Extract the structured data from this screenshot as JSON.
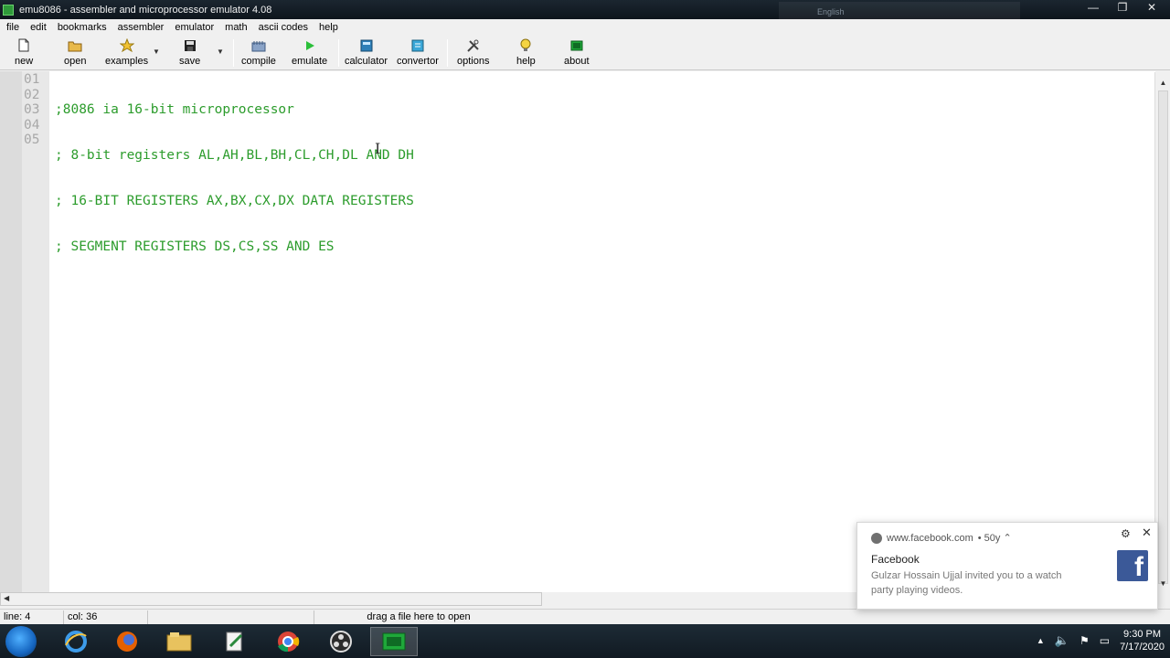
{
  "window": {
    "title": "emu8086 - assembler and microprocessor emulator 4.08",
    "overlay_text": "English",
    "buttons": {
      "minimize": "—",
      "maximize": "❐",
      "close": "✕"
    }
  },
  "menu": [
    "file",
    "edit",
    "bookmarks",
    "assembler",
    "emulator",
    "math",
    "ascii codes",
    "help"
  ],
  "toolbar": {
    "new": "new",
    "open": "open",
    "examples": "examples",
    "save": "save",
    "compile": "compile",
    "emulate": "emulate",
    "calculator": "calculator",
    "convertor": "convertor",
    "options": "options",
    "help": "help",
    "about": "about"
  },
  "editor": {
    "line_numbers": [
      "01",
      "02",
      "03",
      "04",
      "05"
    ],
    "lines": [
      ";8086 ia 16-bit microprocessor",
      "; 8-bit registers AL,AH,BL,BH,CL,CH,DL AND DH",
      "; 16-BIT REGISTERS AX,BX,CX,DX DATA REGISTERS",
      "; SEGMENT REGISTERS DS,CS,SS AND ES",
      ""
    ],
    "code_color": "#2c9c2c"
  },
  "status": {
    "line": "line: 4",
    "col": "col: 36",
    "hint": "drag a file here to open"
  },
  "notification": {
    "source": "www.facebook.com",
    "time": "• 50y ⌃",
    "title": "Facebook",
    "message": "Gulzar Hossain Ujjal invited you to a watch party playing videos.",
    "brand_color": "#3b5998"
  },
  "taskbar": {
    "time": "9:30 PM",
    "date": "7/17/2020"
  }
}
